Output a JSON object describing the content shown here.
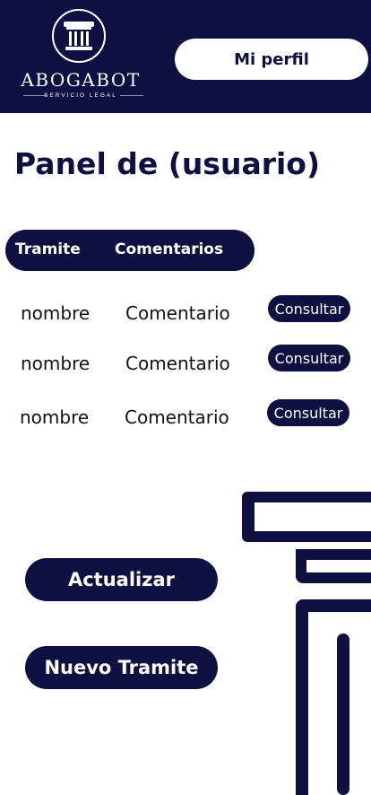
{
  "header": {
    "logo_name": "ABOGABOT",
    "logo_subtitle": "SERVICIO LEGAL",
    "profile_button": "Mi perfil"
  },
  "page": {
    "title": "Panel de (usuario)"
  },
  "table": {
    "columns": [
      "Tramite",
      "Comentarios"
    ],
    "rows": [
      {
        "name": "nombre",
        "comment": "Comentario",
        "action": "Consultar"
      },
      {
        "name": "nombre",
        "comment": "Comentario",
        "action": "Consultar"
      },
      {
        "name": "nombre",
        "comment": "Comentario",
        "action": "Consultar"
      }
    ]
  },
  "actions": {
    "update": "Actualizar",
    "new": "Nuevo Tramite"
  },
  "icons": {
    "logo": "column-icon",
    "decoration": "pillar-icon"
  },
  "colors": {
    "primary": "#0d1040",
    "background": "#ffffff"
  }
}
